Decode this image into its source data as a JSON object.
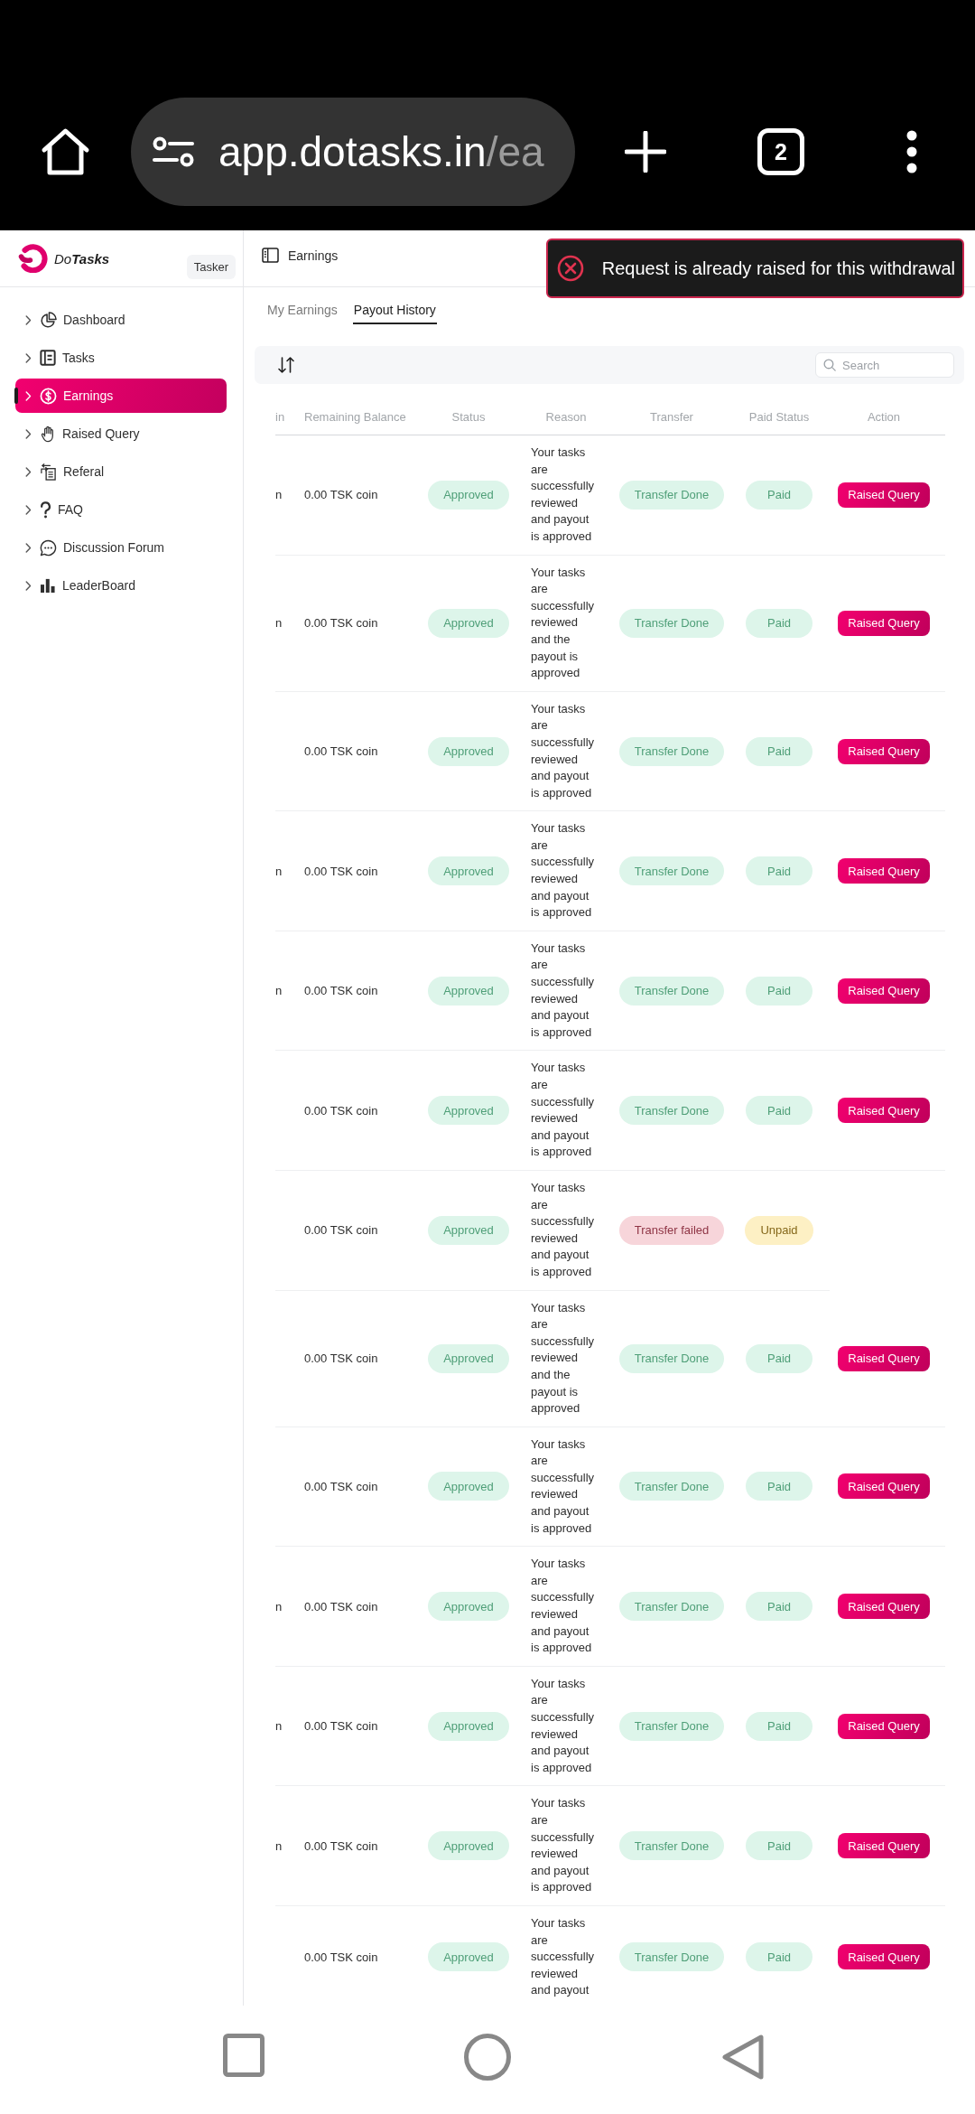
{
  "browser": {
    "url_host": "app.dotasks.in",
    "url_path": "/ea",
    "tab_count": "2"
  },
  "sidebar": {
    "brand": "Do**Tasks**",
    "role": "Tasker",
    "items": [
      {
        "label": "Dashboard",
        "kind": "dashboard",
        "selected": false
      },
      {
        "label": "Tasks",
        "kind": "tasks",
        "selected": false
      },
      {
        "label": "Earnings",
        "kind": "earnings",
        "selected": true
      },
      {
        "label": "Raised Query",
        "kind": "query",
        "selected": false
      },
      {
        "label": "Referal",
        "kind": "referral",
        "selected": false
      },
      {
        "label": "FAQ",
        "kind": "faq",
        "selected": false
      },
      {
        "label": "Discussion Forum",
        "kind": "forum",
        "selected": false
      },
      {
        "label": "LeaderBoard",
        "kind": "leaderboard",
        "selected": false
      }
    ]
  },
  "header": {
    "title": "Earnings"
  },
  "toast": {
    "kind": "error",
    "message": "Request is already raised for this withdrawal"
  },
  "tabs": [
    {
      "label": "My Earnings",
      "selected": false
    },
    {
      "label": "Payout History",
      "selected": true
    }
  ],
  "toolbar": {
    "search": {
      "placeholder": "Search"
    }
  },
  "table": {
    "columns": [
      "in",
      "Remaining Balance",
      "Status",
      "Reason",
      "Transfer",
      "Paid Status",
      "Action"
    ],
    "rows": [
      {
        "column_1": "n",
        "balance": "0.00 TSK coin",
        "status": {
          "label": "Approved",
          "kind": "success"
        },
        "reason": "Your tasks are successfully reviewed and payout is approved",
        "transfer": {
          "label": "Transfer Done",
          "kind": "success"
        },
        "paid_status": {
          "label": "Paid",
          "kind": "success"
        },
        "action": "Raised Query"
      },
      {
        "column_1": "n",
        "balance": "0.00 TSK coin",
        "status": {
          "label": "Approved",
          "kind": "success"
        },
        "reason": "Your tasks are successfully reviewed and the payout is approved",
        "transfer": {
          "label": "Transfer Done",
          "kind": "success"
        },
        "paid_status": {
          "label": "Paid",
          "kind": "success"
        },
        "action": "Raised Query"
      },
      {
        "balance": "0.00 TSK coin",
        "status": {
          "label": "Approved",
          "kind": "success"
        },
        "reason": "Your tasks are successfully reviewed and payout is approved",
        "transfer": {
          "label": "Transfer Done",
          "kind": "success"
        },
        "paid_status": {
          "label": "Paid",
          "kind": "success"
        },
        "action": "Raised Query"
      },
      {
        "column_1": "n",
        "balance": "0.00 TSK coin",
        "status": {
          "label": "Approved",
          "kind": "success"
        },
        "reason": "Your tasks are successfully reviewed and payout is approved",
        "transfer": {
          "label": "Transfer Done",
          "kind": "success"
        },
        "paid_status": {
          "label": "Paid",
          "kind": "success"
        },
        "action": "Raised Query"
      },
      {
        "column_1": "n",
        "balance": "0.00 TSK coin",
        "status": {
          "label": "Approved",
          "kind": "success"
        },
        "reason": "Your tasks are successfully reviewed and payout is approved",
        "transfer": {
          "label": "Transfer Done",
          "kind": "success"
        },
        "paid_status": {
          "label": "Paid",
          "kind": "success"
        },
        "action": "Raised Query"
      },
      {
        "balance": "0.00 TSK coin",
        "status": {
          "label": "Approved",
          "kind": "success"
        },
        "reason": "Your tasks are successfully reviewed and payout is approved",
        "transfer": {
          "label": "Transfer Done",
          "kind": "success"
        },
        "paid_status": {
          "label": "Paid",
          "kind": "success"
        },
        "action": "Raised Query"
      },
      {
        "balance": "0.00 TSK coin",
        "status": {
          "label": "Approved",
          "kind": "success"
        },
        "reason": "Your tasks are successfully reviewed and payout is approved",
        "transfer": {
          "label": "Transfer failed",
          "kind": "danger"
        },
        "paid_status": {
          "label": "Unpaid",
          "kind": "warning"
        }
      },
      {
        "balance": "0.00 TSK coin",
        "status": {
          "label": "Approved",
          "kind": "success"
        },
        "reason": "Your tasks are successfully reviewed and the payout is approved",
        "transfer": {
          "label": "Transfer Done",
          "kind": "success"
        },
        "paid_status": {
          "label": "Paid",
          "kind": "success"
        },
        "action": "Raised Query"
      },
      {
        "balance": "0.00 TSK coin",
        "status": {
          "label": "Approved",
          "kind": "success"
        },
        "reason": "Your tasks are successfully reviewed and payout is approved",
        "transfer": {
          "label": "Transfer Done",
          "kind": "success"
        },
        "paid_status": {
          "label": "Paid",
          "kind": "success"
        },
        "action": "Raised Query"
      },
      {
        "column_1": "n",
        "balance": "0.00 TSK coin",
        "status": {
          "label": "Approved",
          "kind": "success"
        },
        "reason": "Your tasks are successfully reviewed and payout is approved",
        "transfer": {
          "label": "Transfer Done",
          "kind": "success"
        },
        "paid_status": {
          "label": "Paid",
          "kind": "success"
        },
        "action": "Raised Query"
      },
      {
        "column_1": "n",
        "balance": "0.00 TSK coin",
        "status": {
          "label": "Approved",
          "kind": "success"
        },
        "reason": "Your tasks are successfully reviewed and payout is approved",
        "transfer": {
          "label": "Transfer Done",
          "kind": "success"
        },
        "paid_status": {
          "label": "Paid",
          "kind": "success"
        },
        "action": "Raised Query"
      },
      {
        "column_1": "n",
        "balance": "0.00 TSK coin",
        "status": {
          "label": "Approved",
          "kind": "success"
        },
        "reason": "Your tasks are successfully reviewed and payout is approved",
        "transfer": {
          "label": "Transfer Done",
          "kind": "success"
        },
        "paid_status": {
          "label": "Paid",
          "kind": "success"
        },
        "action": "Raised Query"
      },
      {
        "balance": "0.00 TSK coin",
        "status": {
          "label": "Approved",
          "kind": "success"
        },
        "reason": "Your tasks are successfully reviewed and payout",
        "transfer": {
          "label": "Transfer Done",
          "kind": "success"
        },
        "paid_status": {
          "label": "Paid",
          "kind": "success"
        },
        "action": "Raised Query"
      }
    ]
  }
}
